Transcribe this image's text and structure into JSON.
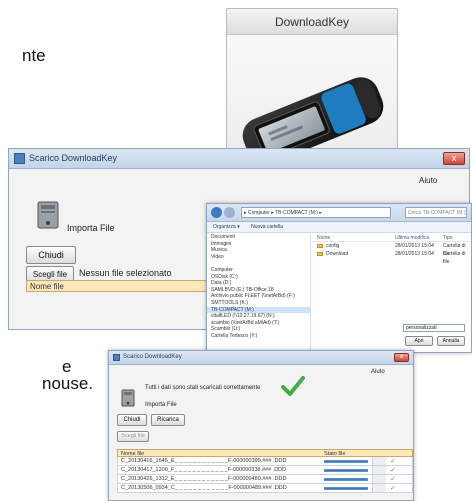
{
  "text_fragments": {
    "top": "nte",
    "mid": "e",
    "bottom": "nouse."
  },
  "product_card": {
    "title": "DownloadKey"
  },
  "main_window": {
    "title": "Scarico DownloadKey",
    "close": "x",
    "menu_help": "Aiuto",
    "import_label": "Importa File",
    "close_button": "Chiudi",
    "choose_button": "Scegli file",
    "no_file_text": "Nessun file selezionato",
    "file_header": "Nome file"
  },
  "explorer": {
    "address": "▸ Computer ▸ TB-COMPACT (M:) ▸",
    "search_placeholder": "Cerca TB-COMPACT (M:)",
    "toolbar": [
      "Organizza ▾",
      "Nuova cartella"
    ],
    "nav_items": [
      "Documenti",
      "Immagini",
      "Musica",
      "Video",
      "",
      "Computer",
      "OSDisk (C:)",
      "Data (D:)",
      "SAMLBVD (E:) TB-Office.18",
      "Archivio public FLEET (\\\\netArBd) (F:)",
      "SMTTOOLS (K:)",
      "TB-COMPACT (M:)",
      "vitalfLED (\\\\10.27.19.67) (N:)",
      "scambio (\\\\netArBd.aMiAd) (T:)",
      "Scambio (U:)",
      "Cartella Tedesco (Y:)"
    ],
    "selected_nav": "TB-COMPACT (M:)",
    "columns": [
      "Nome",
      "Ultima modifica",
      "Tipo"
    ],
    "rows": [
      {
        "name": "config",
        "date": "28/01/2013 15:04",
        "type": "Cartella di file"
      },
      {
        "name": "Download",
        "date": "28/01/2013 15:04",
        "type": "Cartella di file"
      }
    ],
    "file_type": "personalizzati",
    "open_button": "Apri",
    "cancel_button": "Annulla"
  },
  "result_window": {
    "title": "Scarico DownloadKey",
    "menu_help": "Aiuto",
    "success_message": "Tutti i dati sono stati scaricati correttamente",
    "import_label": "Importa File",
    "close_button": "Chiudi",
    "reload_button": "Ricarica",
    "choose_button": "Scegli file",
    "col_name": "Nome file",
    "col_date": "Stato file",
    "rows": [
      {
        "name": "C_20130416_1646_E_ _ _ _ _ _ _ _ _ _ _ _F-000000399.### .DDD",
        "progress": 1.0
      },
      {
        "name": "C_20130417_1200_F_ _ _ _ _ _ _ _ _ _ _ _F-000000338.### .DDD",
        "progress": 1.0
      },
      {
        "name": "C_20130426_1312_E_ _ _ _ _ _ _ _ _ _ _ _F-000000489.### .DDD",
        "progress": 1.0
      },
      {
        "name": "C_20130506_0934_C_ _ _ _ _ _ _ _ _ _ _ _F-000000489.### .DDD",
        "progress": 1.0
      }
    ]
  }
}
